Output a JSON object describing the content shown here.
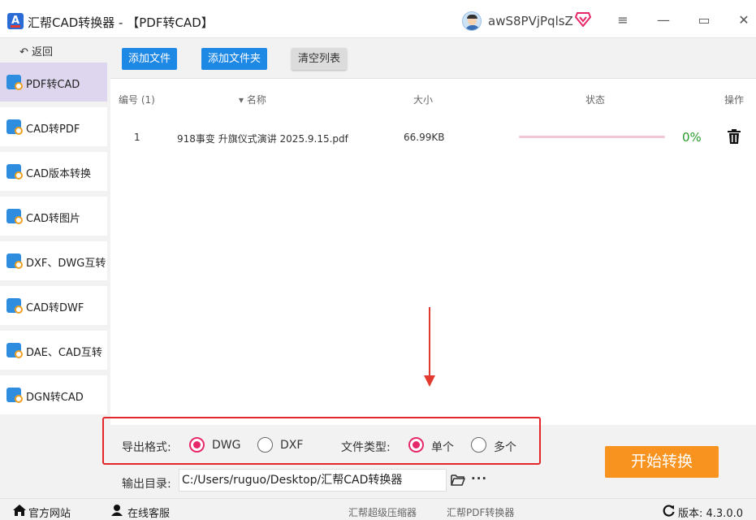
{
  "titlebar": {
    "title": "汇帮CAD转换器 - 【PDF转CAD】",
    "username": "awS8PVjPqlsZ",
    "minimize": "—",
    "maximize": "▭",
    "close": "✕",
    "menu": "≡"
  },
  "sidebar": {
    "back_label": "↶ 返回",
    "items": [
      {
        "label": "PDF转CAD"
      },
      {
        "label": "CAD转PDF"
      },
      {
        "label": "CAD版本转换"
      },
      {
        "label": "CAD转图片"
      },
      {
        "label": "DXF、DWG互转"
      },
      {
        "label": "CAD转DWF"
      },
      {
        "label": "DAE、CAD互转"
      },
      {
        "label": "DGN转CAD"
      }
    ]
  },
  "toolbar": {
    "add_file": "添加文件",
    "add_folder": "添加文件夹",
    "clear_list": "清空列表"
  },
  "table": {
    "headers": {
      "index": "编号 (1)",
      "name": "▾ 名称",
      "size": "大小",
      "status": "状态",
      "action": "操作"
    },
    "rows": [
      {
        "index": "1",
        "name": "918事变 升旗仪式演讲 2025.9.15.pdf",
        "size": "66.99KB",
        "progress": 0,
        "progress_label": "0%"
      }
    ]
  },
  "options": {
    "format_label": "导出格式:",
    "format_dwg": "DWG",
    "format_dxf": "DXF",
    "type_label": "文件类型:",
    "type_single": "单个",
    "type_multi": "多个",
    "selected_format": "DWG",
    "selected_type": "单个"
  },
  "output": {
    "label": "输出目录:",
    "path": "C:/Users/ruguo/Desktop/汇帮CAD转换器",
    "more": "···"
  },
  "start_button": "开始转换",
  "statusbar": {
    "website": "官方网站",
    "support": "在线客服",
    "link1": "汇帮超级压缩器",
    "link2": "汇帮PDF转换器",
    "version": "版本: 4.3.0.0"
  },
  "colors": {
    "accent_blue": "#1e88e5",
    "start_orange": "#f7931e",
    "radio_pink": "#e6286a",
    "highlight_red": "#e4262a",
    "percent_green": "#2a9a2a"
  }
}
